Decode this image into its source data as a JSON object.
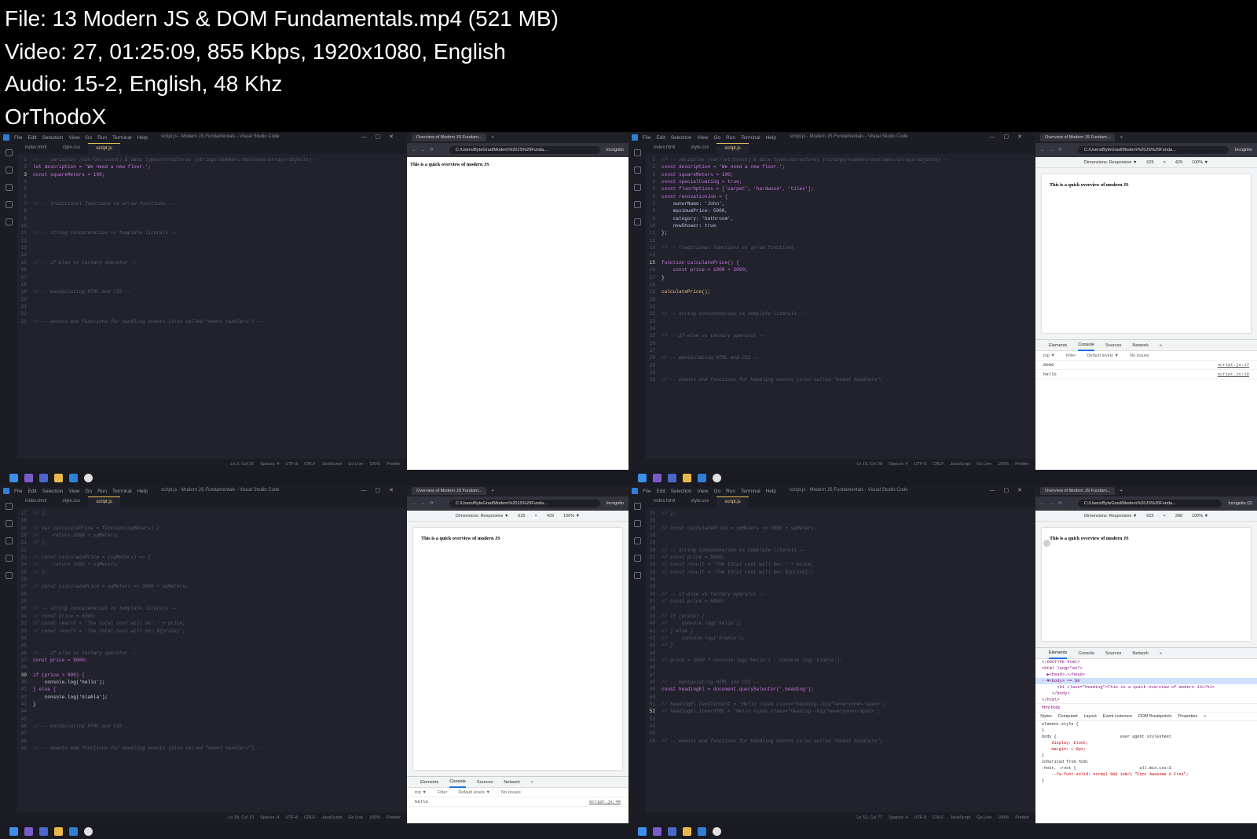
{
  "info": {
    "file": "File: 13  Modern JS & DOM Fundamentals.mp4 (521 MB)",
    "video": "Video: 27, 01:25:09, 855 Kbps, 1920x1080, English",
    "audio": "Audio: 15-2, English, 48 Khz",
    "author": "OrThodoX"
  },
  "common": {
    "menu": [
      "File",
      "Edit",
      "Selection",
      "View",
      "Go",
      "Run",
      "Terminal",
      "Help"
    ],
    "window_title": "script.js - Modern JS Fundamentals - Visual Studio Code",
    "tabs": [
      "index.html",
      "style.css",
      "script.js"
    ],
    "browser_tab": "Overview of Modern JS Fundam...",
    "url": "C:/Users/ByteGrad/Modern%20JS%20Funda...",
    "incognito": "Incognito",
    "page_heading": "This is a quick overview of modern JS",
    "dev_dim": "Dimensions: Responsive ▼",
    "dev_zoom": "100% ▼",
    "devtools_tabs": [
      "Elements",
      "Console",
      "Sources",
      "Network",
      "»"
    ],
    "filter_label": "Filter",
    "default_levels": "Default levels ▼",
    "no_issues": "No Issues",
    "context_top": "top ▼"
  },
  "frame1": {
    "status": [
      "Ln 3, Col 26",
      "Spaces: 4",
      "UTF-8",
      "CRLF",
      "JavaScript",
      "Go Live",
      "100%",
      "Prettier"
    ],
    "code": [
      [
        "1",
        "// -- variables (var/let/const) & data types/structures (strings/numbers/booleans/arrays/objects) --"
      ],
      [
        "2",
        "let description = 'We need a new floor.';"
      ],
      [
        "3",
        "const squareMeters = 100;"
      ],
      [
        "4",
        ""
      ],
      [
        "5",
        ""
      ],
      [
        "6",
        ""
      ],
      [
        "7",
        "// -- traditional functions vs arrow functions --"
      ],
      [
        "8",
        ""
      ],
      [
        "9",
        ""
      ],
      [
        "10",
        ""
      ],
      [
        "11",
        "// -- string concatenation vs template literals --"
      ],
      [
        "12",
        ""
      ],
      [
        "13",
        ""
      ],
      [
        "14",
        ""
      ],
      [
        "15",
        "// -- if-else vs ternary operator --"
      ],
      [
        "16",
        ""
      ],
      [
        "17",
        ""
      ],
      [
        "18",
        ""
      ],
      [
        "19",
        "// -- manipulating HTML and CSS --"
      ],
      [
        "20",
        ""
      ],
      [
        "21",
        ""
      ],
      [
        "22",
        ""
      ],
      [
        "23",
        "// -- events and functions for handling events (also called \"event handlers\") --"
      ]
    ]
  },
  "frame2": {
    "status": [
      "Ln 15, Col 28",
      "Spaces: 4",
      "UTF-8",
      "CRLF",
      "JavaScript",
      "Go Live",
      "100%",
      "Prettier"
    ],
    "dev_w": "625",
    "dev_h": "429",
    "console": [
      [
        "8000",
        "script.js:17"
      ],
      [
        "hello",
        "script.js:18"
      ]
    ],
    "code": [
      [
        "1",
        "// -- variables (var/let/const) & data types/structures (strings/numbers/booleans/arrays/objects) --"
      ],
      [
        "2",
        "const description = 'We need a new floor.';"
      ],
      [
        "3",
        "const squareMeters = 100;"
      ],
      [
        "4",
        "const specialCoating = true;"
      ],
      [
        "5",
        "const floorOptions = ['carpet', 'hardwood', 'tiles'];"
      ],
      [
        "6",
        "const renovationJob = {"
      ],
      [
        "7",
        "    ownerName: 'John',"
      ],
      [
        "8",
        "    maximumPrice: 5000,"
      ],
      [
        "9",
        "    category: 'bathroom',"
      ],
      [
        "10",
        "    newShower: true"
      ],
      [
        "11",
        "};"
      ],
      [
        "12",
        ""
      ],
      [
        "13",
        "// -- traditional functions vs arrow functions --"
      ],
      [
        "14",
        ""
      ],
      [
        "15",
        "function calculatePrice() {"
      ],
      [
        "16",
        "    const price = 1000 + 3000;"
      ],
      [
        "17",
        "}"
      ],
      [
        "18",
        ""
      ],
      [
        "19",
        "calculatePrice();"
      ],
      [
        "20",
        ""
      ],
      [
        "21",
        ""
      ],
      [
        "22",
        "// -- string concatenation vs template literals --"
      ],
      [
        "23",
        ""
      ],
      [
        "24",
        ""
      ],
      [
        "25",
        "// -- if-else vs ternary operator --"
      ],
      [
        "26",
        ""
      ],
      [
        "27",
        ""
      ],
      [
        "28",
        "// -- manipulating HTML and CSS --"
      ],
      [
        "29",
        ""
      ],
      [
        "30",
        ""
      ],
      [
        "31",
        "// -- events and functions for handling events (also called \"event handlers\") --"
      ]
    ]
  },
  "frame3": {
    "status": [
      "Ln 39, Col 13",
      "Spaces: 4",
      "UTF-8",
      "CRLF",
      "JavaScript",
      "Go Live",
      "100%",
      "Prettier"
    ],
    "dev_w": "625",
    "dev_h": "429",
    "console": [
      [
        "hello",
        "script.js:40"
      ]
    ],
    "code": [
      [
        "17",
        "// };"
      ],
      [
        "18",
        ""
      ],
      [
        "19",
        "// var calculatePrice = function(sqMeters) {"
      ],
      [
        "20",
        "//     return 2000 + sqMeters;"
      ],
      [
        "21",
        "// };"
      ],
      [
        "22",
        ""
      ],
      [
        "23",
        "// const calculatePrice = (sqMeters) => {"
      ],
      [
        "24",
        "//     return 1000 + sqMeters;"
      ],
      [
        "25",
        "// };"
      ],
      [
        "26",
        ""
      ],
      [
        "27",
        "// const calculatePrice = sqMeters => 3000 + sqMeters;"
      ],
      [
        "28",
        ""
      ],
      [
        "29",
        ""
      ],
      [
        "30",
        "// -- string concatenation vs template literals --"
      ],
      [
        "31",
        "// const price = 5000;"
      ],
      [
        "32",
        "// const result = 'The total cost will be: ' + price;"
      ],
      [
        "33",
        "// const result = 'The total cost will be: ${price}';"
      ],
      [
        "34",
        ""
      ],
      [
        "35",
        ""
      ],
      [
        "36",
        "// -- if-else vs ternary operator --"
      ],
      [
        "37",
        "const price = 5000;"
      ],
      [
        "38",
        ""
      ],
      [
        "39",
        "if (price > 900) {"
      ],
      [
        "40",
        "    console.log('hello');"
      ],
      [
        "41",
        "} else {"
      ],
      [
        "42",
        "    console.log('blabla');"
      ],
      [
        "43",
        "}"
      ],
      [
        "44",
        ""
      ],
      [
        "45",
        ""
      ],
      [
        "46",
        "// -- manipulating HTML and CSS --"
      ],
      [
        "47",
        ""
      ],
      [
        "48",
        ""
      ],
      [
        "49",
        "// -- events and functions for handling events (also called \"event handlers\") --"
      ]
    ]
  },
  "frame4": {
    "status": [
      "Ln 52, Col 77",
      "Spaces: 4",
      "UTF-8",
      "CRLF",
      "JavaScript",
      "Go Live",
      "100%",
      "Prettier"
    ],
    "dev_w": "622",
    "dev_h": "288",
    "incognito": "Incognito (2)",
    "elements": [
      "<!DOCTYPE html>",
      "<html lang=\"en\">",
      "  ▶<head>…</head>",
      "··▼<body> == $0",
      "      <h1 class=\"heading\">This is a quick overview of modern JS</h1>",
      "    </body>",
      "</html>"
    ],
    "crumbs": "html  body",
    "style_tabs": [
      "Styles",
      "Computed",
      "Layout",
      "Event Listeners",
      "DOM Breakpoints",
      "Properties",
      "»"
    ],
    "styles": [
      "element.style {",
      "}",
      "body {                          user agent stylesheet",
      "    display: block;",
      "    margin: ▸ 8px;",
      "}",
      "Inherited from html",
      ":host, :root {                          all.min.css:5",
      "    --fa-font-solid: normal 900 1em/1 \"Font Awesome 6 Free\";",
      "}"
    ],
    "code": [
      [
        "25",
        "// };"
      ],
      [
        "26",
        ""
      ],
      [
        "27",
        "// const calculatePrice = sqMeters => 3000 + sqMeters;"
      ],
      [
        "28",
        ""
      ],
      [
        "29",
        ""
      ],
      [
        "30",
        "// -- string concatenation vs template literals --"
      ],
      [
        "31",
        "// const price = 5000;"
      ],
      [
        "32",
        "// const result = 'The total cost will be: ' + price;"
      ],
      [
        "33",
        "// const result = 'The total cost will be: ${price}';"
      ],
      [
        "34",
        ""
      ],
      [
        "35",
        ""
      ],
      [
        "36",
        "// -- if-else vs ternary operator --"
      ],
      [
        "37",
        "// const price = 5000;"
      ],
      [
        "38",
        ""
      ],
      [
        "39",
        "// if (price) {"
      ],
      [
        "40",
        "//     console.log('hello');"
      ],
      [
        "41",
        "// } else {"
      ],
      [
        "42",
        "//     console.log('blabla');"
      ],
      [
        "43",
        "// }"
      ],
      [
        "44",
        ""
      ],
      [
        "45",
        "// price > 3000 ? console.log('hello') : console.log('blabla');"
      ],
      [
        "46",
        ""
      ],
      [
        "47",
        ""
      ],
      [
        "48",
        "// -- manipulating HTML and CSS --"
      ],
      [
        "49",
        "const headingEl = document.querySelector('.heading');"
      ],
      [
        "50",
        ""
      ],
      [
        "51",
        "// headingEl.textContent = 'Hello <span class=\"heading--big\">everyone</span>';"
      ],
      [
        "52",
        "// headingEl.innerHTML = 'Hello <span class=\"heading--big\">everyone</span>';"
      ],
      [
        "53",
        ""
      ],
      [
        "54",
        ""
      ],
      [
        "55",
        ""
      ],
      [
        "56",
        "// -- events and functions for handling events (also called \"event handlers\") --"
      ]
    ]
  }
}
